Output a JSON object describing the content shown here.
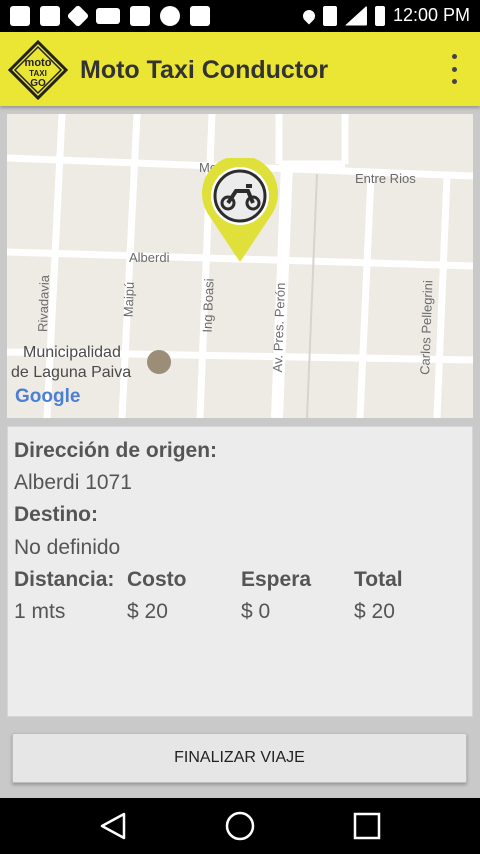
{
  "status_bar": {
    "time": "12:00 PM"
  },
  "app_bar": {
    "title": "Moto Taxi Conductor",
    "logo_text": [
      "moto",
      "TAXI",
      "GO"
    ]
  },
  "map": {
    "streets": [
      "Entre Rios",
      "Alberdi",
      "Rivadavia",
      "Maipú",
      "Ing Boasi",
      "Av. Pres. Perón",
      "Carlos Pellegrini",
      "Mo"
    ],
    "place": [
      "Municipalidad",
      "de Laguna Paiva"
    ],
    "attribution": "Google"
  },
  "trip": {
    "origin_label": "Dirección de origen:",
    "origin_value": "Alberdi 1071",
    "destination_label": "Destino:",
    "destination_value": "No definido",
    "columns": [
      {
        "label": "Distancia:",
        "value": "1 mts"
      },
      {
        "label": "Costo",
        "value": "$ 20"
      },
      {
        "label": "Espera",
        "value": "$ 0"
      },
      {
        "label": "Total",
        "value": "$ 20"
      }
    ]
  },
  "actions": {
    "finish_label": "FINALIZAR VIAJE"
  },
  "colors": {
    "app_bar": "#ebe634",
    "marker": "#dfe03a"
  },
  "icons": {
    "status_left": [
      "messenger-icon",
      "gallery-icon",
      "tidal-icon",
      "youtube-icon",
      "square-icon",
      "twitter-icon",
      "voicemail-icon"
    ],
    "status_right": [
      "location-icon",
      "nfc-icon",
      "signal-icon",
      "battery-icon"
    ],
    "nav": [
      "back-icon",
      "home-icon",
      "recents-icon"
    ]
  }
}
